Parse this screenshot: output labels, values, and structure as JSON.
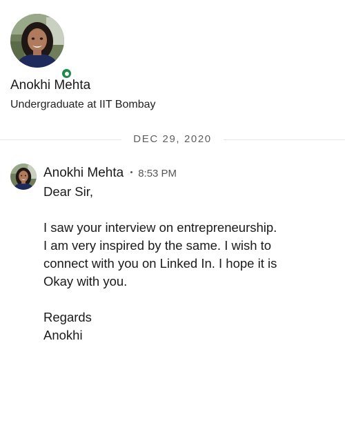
{
  "profile": {
    "name": "Anokhi Mehta",
    "headline": "Undergraduate at IIT Bombay",
    "status": "online",
    "status_color": "#1f8a49"
  },
  "conversation": {
    "date_divider": "DEC 29, 2020",
    "messages": [
      {
        "sender": "Anokhi Mehta",
        "time": "8:53 PM",
        "lines": {
          "greeting": "Dear Sir,",
          "l1": "I saw your interview on entrepreneurship.",
          "l2": "I am very inspired by the same. I wish to",
          "l3": "connect with you on Linked In. I hope it is",
          "l4": "Okay with you.",
          "closing": "Regards",
          "signature": "Anokhi"
        }
      }
    ]
  }
}
